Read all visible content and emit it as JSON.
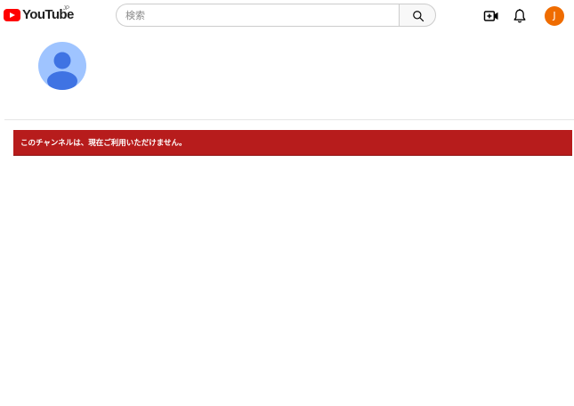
{
  "header": {
    "logo_text": "YouTube",
    "region_code": "JP",
    "search_placeholder": "検索",
    "search_value": "",
    "icons": {
      "search": "search-icon",
      "create": "create-video-icon",
      "notifications": "bell-icon"
    },
    "account_initial": "J",
    "account_color": "#ef6c00"
  },
  "channel": {
    "avatar_icon": "default-avatar-icon",
    "avatar_color": "#9fc4ff"
  },
  "error": {
    "message": "このチャンネルは、現在ご利用いただけません。",
    "color": "#b71c1c"
  }
}
